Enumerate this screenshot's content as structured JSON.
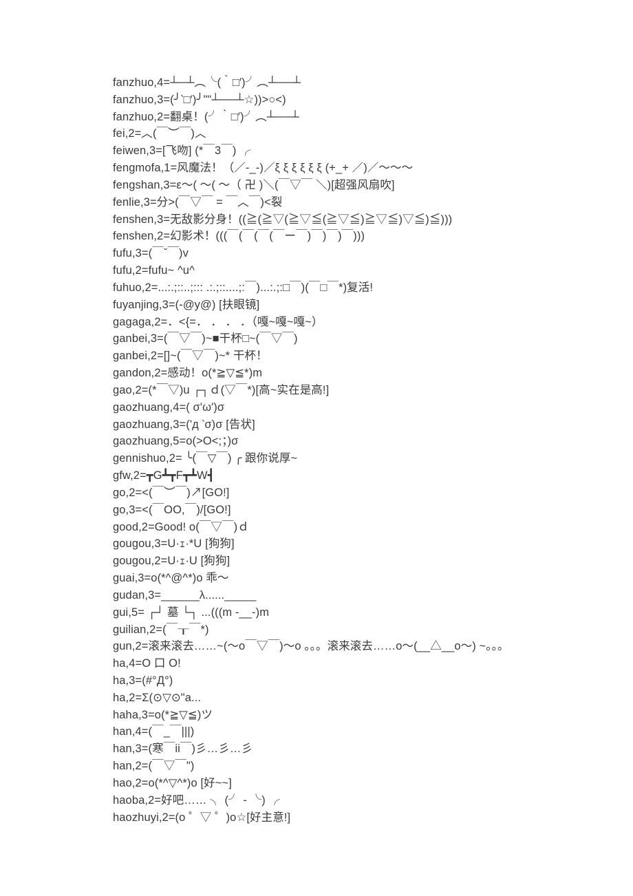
{
  "lines": [
    "fanzhuo,4=┴─┴︵╰(‵□′)╯︵┴──┴",
    "fanzhuo,3=(╯‵□′)╯\"\"┴──┴☆))>○<)",
    "fanzhuo,2=翻桌！(╯‵□′)╯︵┴──┴",
    "fei,2=︿(￣︶￣)︿",
    "feiwen,3=[飞吻] (*￣3￣) ╭",
    "fengmofa,1=风魔法！（／-_-)／ξ ξ ξ ξ ξ ξ (+_+ ／)／～～～",
    "fengshan,3=ε～( ～( ～（ 卍 )＼(￣▽￣ ＼)[超强风扇吹]",
    "fenlie,3=分>(￣▽￣ = ￣︿￣)<裂",
    "fenshen,3=无敌影分身！((≧(≧▽(≧▽≦(≧▽≦)≧▽≦)▽≦)≦)))",
    "fenshen,2=幻影术！(((￣(￣(￣(￣ー￣)￣)￣)￣)))",
    "fufu,3=(￣ˇ￣)v",
    "fufu,2=fufu~ ^u^",
    "fuhuo,2=...:.;::..;::: .:.;::....;:￣)...:.;:□￣)(￣□￣*)复活!",
    "fuyanjing,3=(-@y@) [扶眼镜]",
    "gagaga,2=．<{=． ． ． ．（嘎~嘎~嘎~）",
    "ganbei,3=(￣▽￣)~■干杯□~(￣▽￣)",
    "ganbei,2=[]~(￣▽￣)~* 干杯！",
    "gandon,2=感动！o(*≧▽≦*)m",
    "gao,2=(*￣▽)u ┌┐ｄ(▽￣*)[高~实在是高!]",
    "gaozhuang,4=( σ'ω')σ",
    "gaozhuang,3=('д ‵σ)σ [告状]",
    "gaozhuang,5=o(>O<;；)σ",
    "gennishuo,2= ╰(￣▽￣) ╭ 跟你说厚~",
    "gfw,2=┳G┻┳F┳┻W┫",
    "go,2=<(￣︶￣)↗[GO!]",
    "go,3=<(￣OO,￣)/[GO!]",
    "good,2=Good! o(￣▽￣)ｄ",
    "gougou,3=U·ｪ·*U [狗狗]",
    "gougou,2=U·ｪ·U [狗狗]",
    "guai,3=o(*^@^*)o 乖～",
    "gudan,3=______λ......_____",
    "gui,5= ┌┘ 墓 └┐ ...(((m -__-)m",
    "guilian,2=(￣┰￣*)",
    "gun,2=滚来滚去……~(～o￣▽￣)～o 。。。滚来滚去……o～(__△__o～) ~。。。",
    "ha,4=O 口 O!",
    "ha,3=(#°Д°)",
    "ha,2=Σ(⊙▽⊙\"a...",
    "haha,3=o(*≧▽≦)ツ",
    "han,4=(￣_￣|||)",
    "han,3=(寒￣ii￣)彡…彡…彡",
    "han,2=(￣▽￣\")",
    "hao,2=o(*^▽^*)o [好~~]",
    "haoba,2=好吧…… ╮ (╯ - ╰) ╭",
    "haozhuyi,2=(o ゜▽ ゜)o☆[好主意!]"
  ]
}
